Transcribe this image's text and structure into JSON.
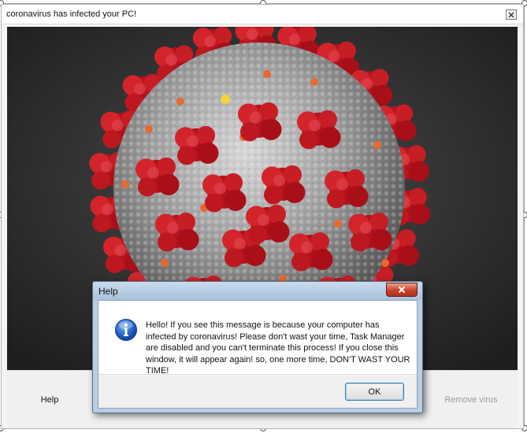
{
  "main_window": {
    "title": "coronavirus has infected your PC!",
    "close_icon": "close-icon"
  },
  "virus_image": {
    "subject": "coronavirus-illustration",
    "colors": {
      "background": "#2f2f2f",
      "body": "#a6a6a6",
      "spike": "#c21a22",
      "protein": "#e8692e"
    }
  },
  "buttons": {
    "help_label": "Help",
    "remove_virus_label": "Remove virus"
  },
  "dialog": {
    "title": "Help",
    "close_icon": "close-icon",
    "icon": "info-icon",
    "message": "Hello! If you see this message is because your computer has infected by coronavirus! Please don't wast your time, Task Manager are disabled and you can't terminate this process! If you close this window, it will appear again! so, one more time, DON'T WAST YOUR TIME!",
    "ok_label": "OK"
  }
}
